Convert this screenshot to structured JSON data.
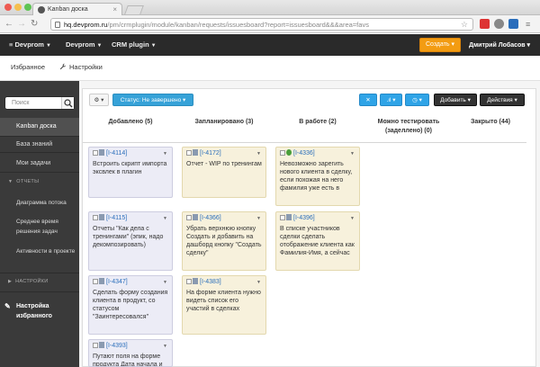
{
  "browser": {
    "tab_title": "Kanban доска",
    "url_host": "hq.devprom.ru",
    "url_path": "/pm/crmplugin/module/kanban/requests/issuesboard?report=issuesboard&&&area=favs"
  },
  "header": {
    "menus": [
      "Devprom",
      "Devprom",
      "CRM plugin"
    ],
    "create_label": "Создать",
    "user_name": "Дмитрий Лобасов"
  },
  "subnav": {
    "favorites": "Избранное",
    "settings": "Настройки"
  },
  "sidebar": {
    "search_placeholder": "Поиск",
    "items": [
      {
        "label": "Kanban доска",
        "active": true
      },
      {
        "label": "База знаний"
      },
      {
        "label": "Мои задачи"
      }
    ],
    "reports_section": "ОТЧЕТЫ",
    "report_items": [
      {
        "label": "Диаграмма потока"
      },
      {
        "label": "Среднее время решения задач"
      },
      {
        "label": "Активности в проекте"
      }
    ],
    "settings_section": "НАСТРОЙКИ",
    "fav_settings": "Настройка избранного"
  },
  "toolbar": {
    "status_filter": "Статус: Не завершено",
    "add_label": "Добавить",
    "actions_label": "Действия"
  },
  "columns": [
    {
      "title": "Добавлено (5)"
    },
    {
      "title": "Запланировано (3)"
    },
    {
      "title": "В работе (2)"
    },
    {
      "title": "Можно тестировать (заделлено) (0)"
    },
    {
      "title": "Закрыто (44)"
    }
  ],
  "cards": [
    {
      "id": "[I-4114]",
      "text": "Встроить скрипт импорта эксвлек в плагин",
      "color": "lilac"
    },
    {
      "id": "[I-4115]",
      "text": "Отчеты \"Как дела с тренингами\" (эпик, надо декомпозировать)",
      "color": "lilac"
    },
    {
      "id": "[I-4347]",
      "text": "Сделать форму создания клиента в продукт, со статусом \"Заинтересовался\"",
      "color": "lilac"
    },
    {
      "id": "[I-4393]",
      "text": "Путают поля на форме продукта Дата начала и",
      "color": "lilac"
    },
    {
      "id": "[I-4172]",
      "text": "Отчет - WIP по тренингам",
      "color": "beige"
    },
    {
      "id": "[I-4366]",
      "text": "Убрать верхнюю кнопку Создать и добавить на дашборд кнопку \"Создать сделку\"",
      "color": "beige"
    },
    {
      "id": "[I-4383]",
      "text": "На форме клиента нужно видеть список его участий в сделках",
      "color": "beige"
    },
    {
      "id": "[I-4336]",
      "text": "Невозможно зарегить нового клиента в сделку, если похожая на него фамилия уже есть в",
      "color": "beige"
    },
    {
      "id": "[I-4396]",
      "text": "В списке участников сделки сделать отображение клиента как Фамилия-Имя, а сейчас",
      "color": "beige"
    }
  ]
}
